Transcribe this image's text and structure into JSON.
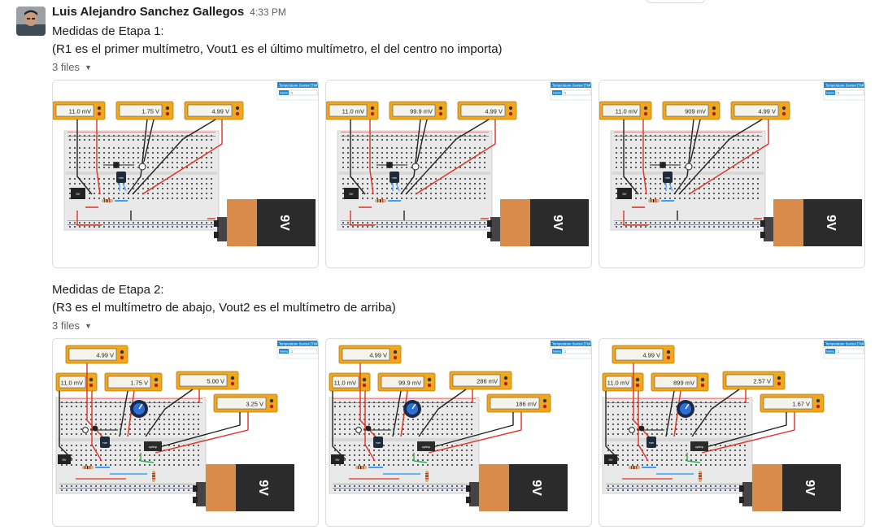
{
  "message": {
    "author": "Luis Alejandro Sanchez Gallegos",
    "time": "4:33 PM",
    "lines": [
      "Medidas de Etapa 1:",
      "(R1 es el primer multímetro, Vout1 es el último multímetro, el del centro no importa)"
    ],
    "files_label": "3 files",
    "lines2": [
      "Medidas de Etapa 2:",
      "(R3 es el multímetro de abajo, Vout2 es el multímetro de arriba)"
    ],
    "files_label2": "3 files"
  },
  "common_labels": {
    "sensor_title": "Temperature Sensor [TMP36]",
    "sensor_name_label": "Name",
    "sensor_name_value": "1",
    "battery_label": "9V",
    "module_label": "5V",
    "chip_label": "TMP",
    "opamp_label": "op4mp"
  },
  "stage1": [
    {
      "m1": "11.0 mV",
      "m2": "1.75 V",
      "m3": "4.99 V"
    },
    {
      "m1": "11.0 mV",
      "m2": "99.9 mV",
      "m3": "4.99 V"
    },
    {
      "m1": "11.0 mV",
      "m2": "909 mV",
      "m3": "4.99 V"
    }
  ],
  "stage2": [
    {
      "top": "4.99 V",
      "m1": "11.0 mV",
      "m2": "1.75 V",
      "m3": "5.00 V",
      "m4": "3.25 V"
    },
    {
      "top": "4.99 V",
      "m1": "11.0 mV",
      "m2": "99.9 mV",
      "m3": "286 mV",
      "m4": "186 mV"
    },
    {
      "top": "4.99 V",
      "m1": "11.0 mV",
      "m2": "899 mV",
      "m3": "2.57 V",
      "m4": "1.67 V"
    }
  ],
  "colors": {
    "multimeter": "#f2a81d",
    "breadboard": "#e9e9e9",
    "battery_cap": "#d98b4a",
    "battery_body": "#2b2b2b",
    "panel_blue": "#1e88d6"
  }
}
